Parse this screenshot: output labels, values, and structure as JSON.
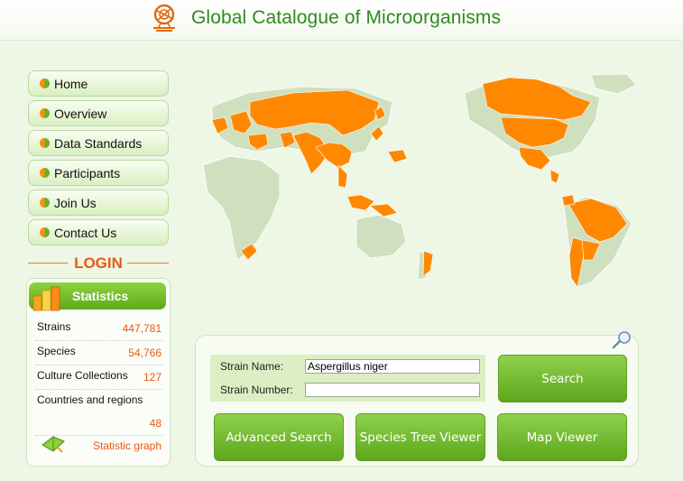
{
  "header": {
    "title": "Global Catalogue of Microorganisms",
    "logo_icon": "microbe-logo-icon"
  },
  "nav": {
    "items": [
      {
        "label": "Home"
      },
      {
        "label": "Overview"
      },
      {
        "label": "Data Standards"
      },
      {
        "label": "Participants"
      },
      {
        "label": "Join Us"
      },
      {
        "label": "Contact Us"
      }
    ]
  },
  "login": {
    "label": "LOGIN"
  },
  "statistics": {
    "title": "Statistics",
    "rows": [
      {
        "label": "Strains",
        "value": "447,781"
      },
      {
        "label": "Species",
        "value": "54,766"
      },
      {
        "label": "Culture Collections",
        "value": "127"
      },
      {
        "label": "Countries and regions",
        "value": "48"
      }
    ],
    "graph_link": "Statistic graph"
  },
  "map": {
    "icon": "world-map",
    "highlight_color": "#ff8800",
    "base_color": "#cfe0bf"
  },
  "search": {
    "strain_name_label": "Strain Name:",
    "strain_name_value": "Aspergillus niger",
    "strain_number_label": "Strain Number:",
    "strain_number_value": "",
    "search_button": "Search",
    "advanced_button": "Advanced  Search",
    "tree_button": "Species Tree Viewer",
    "map_button": "Map Viewer"
  },
  "colors": {
    "accent_green": "#6ab82a",
    "accent_orange": "#e85a10"
  }
}
